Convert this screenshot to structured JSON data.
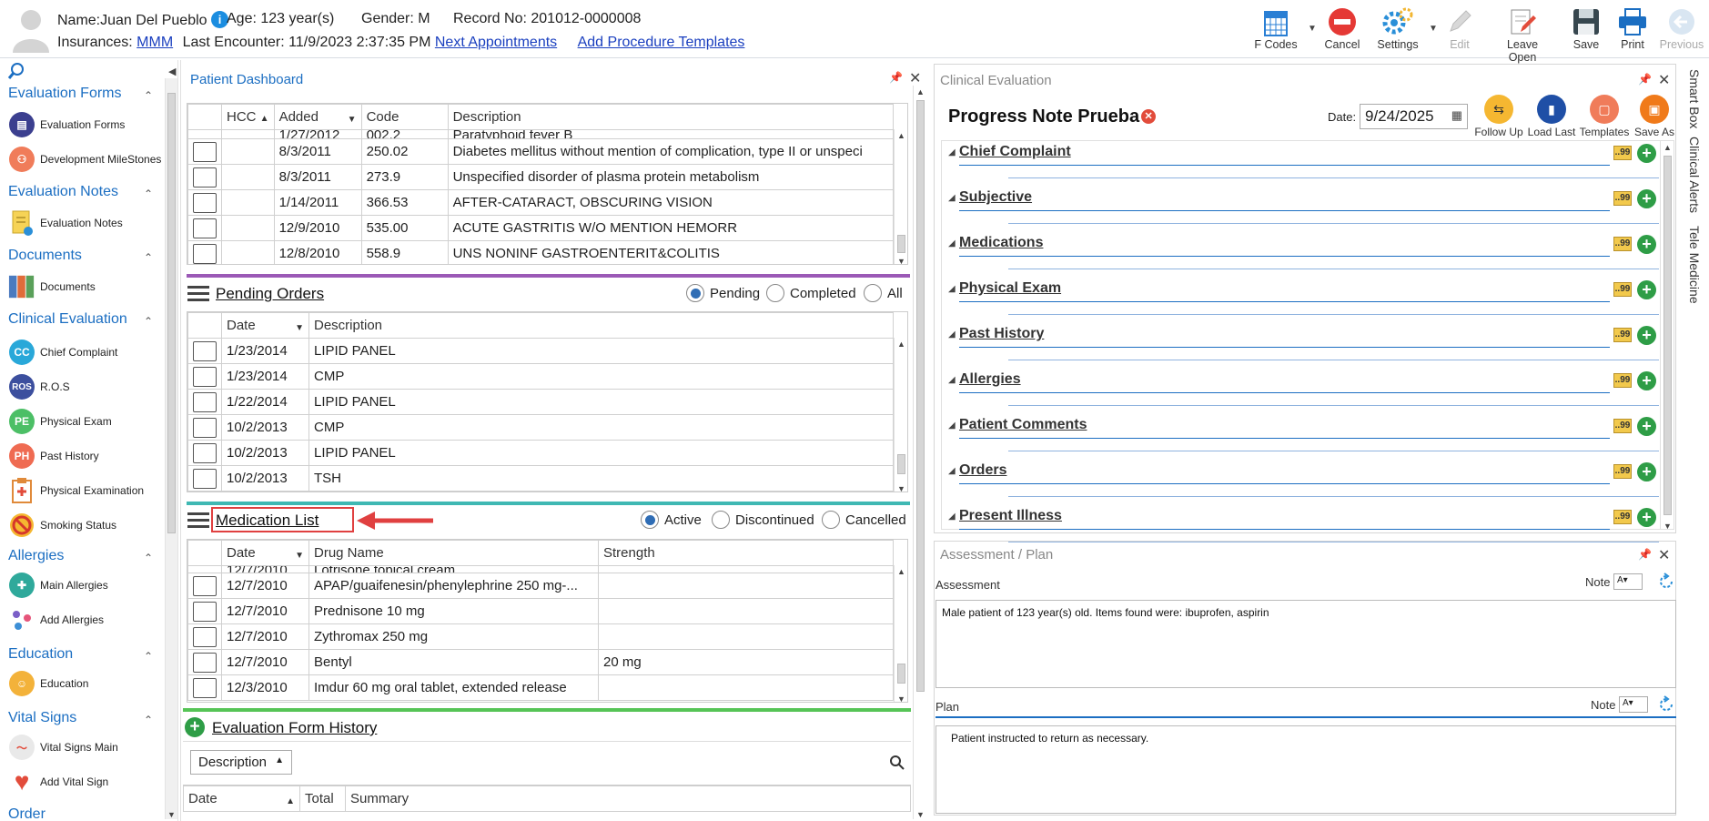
{
  "patient": {
    "name_label": "Name:",
    "name": "Juan Del Pueblo",
    "age_label": "Age:",
    "age": "123 year(s)",
    "gender_label": "Gender:",
    "gender": "M",
    "record_label": "Record No:",
    "record": "201012-0000008",
    "ins_label": "Insurances:",
    "insurance": "MMM",
    "last_label": "Last Encounter:",
    "last_encounter": "11/9/2023 2:37:35 PM",
    "next_appt": "Next Appointments",
    "add_proc": "Add Procedure Templates"
  },
  "toolbar": {
    "fcodes": "F Codes",
    "cancel": "Cancel",
    "settings": "Settings",
    "edit": "Edit",
    "leave_open": "Leave Open",
    "save": "Save",
    "print": "Print",
    "previous": "Previous"
  },
  "sidebar": {
    "evaluation_forms": "Evaluation Forms",
    "ev_forms_item": "Evaluation Forms",
    "dev_milestones": "Development MileStones",
    "evaluation_notes": "Evaluation Notes",
    "ev_notes_item": "Evaluation Notes",
    "documents": "Documents",
    "documents_item": "Documents",
    "clinical_evaluation": "Clinical Evaluation",
    "chief_complaint": "Chief Complaint",
    "ros": "R.O.S",
    "physical_exam": "Physical Exam",
    "past_history": "Past History",
    "physical_examination": "Physical Examination",
    "smoking_status": "Smoking Status",
    "allergies": "Allergies",
    "main_allergies": "Main Allergies",
    "add_allergies": "Add Allergies",
    "education": "Education",
    "education_item": "Education",
    "vital_signs": "Vital Signs",
    "vital_signs_main": "Vital Signs Main",
    "add_vital_sign": "Add Vital Sign",
    "order": "Order",
    "icon_cc": "CC",
    "icon_ros": "ROS",
    "icon_pe": "PE",
    "icon_ph": "PH"
  },
  "dashboard": {
    "title": "Patient Dashboard",
    "problems": {
      "headers": [
        "HCC",
        "Added",
        "Code",
        "Description"
      ],
      "partial_row": {
        "added": "1/27/2012",
        "code": "002.2",
        "desc": "Paratyphoid fever B"
      },
      "rows": [
        {
          "added": "8/3/2011",
          "code": "250.02",
          "desc": "Diabetes mellitus without mention of complication, type II or unspeci"
        },
        {
          "added": "8/3/2011",
          "code": "273.9",
          "desc": "Unspecified disorder of plasma protein metabolism"
        },
        {
          "added": "1/14/2011",
          "code": "366.53",
          "desc": "AFTER-CATARACT, OBSCURING VISION"
        },
        {
          "added": "12/9/2010",
          "code": "535.00",
          "desc": "ACUTE GASTRITIS W/O MENTION HEMORR"
        },
        {
          "added": "12/8/2010",
          "code": "558.9",
          "desc": "UNS NONINF GASTROENTERIT&COLITIS"
        }
      ]
    },
    "pending": {
      "title": "Pending Orders",
      "r_pending": "Pending",
      "r_completed": "Completed",
      "r_all": "All",
      "headers": [
        "Date",
        "Description"
      ],
      "rows": [
        {
          "date": "1/23/2014",
          "desc": "LIPID PANEL"
        },
        {
          "date": "1/23/2014",
          "desc": "CMP"
        },
        {
          "date": "1/22/2014",
          "desc": "LIPID PANEL"
        },
        {
          "date": "10/2/2013",
          "desc": "CMP"
        },
        {
          "date": "10/2/2013",
          "desc": "LIPID PANEL"
        },
        {
          "date": "10/2/2013",
          "desc": "TSH"
        }
      ]
    },
    "meds": {
      "title": "Medication List",
      "r_active": "Active",
      "r_discontinued": "Discontinued",
      "r_cancelled": "Cancelled",
      "headers": [
        "Date",
        "Drug Name",
        "Strength"
      ],
      "partial_row": {
        "date": "12/7/2010",
        "drug": "Lotrisone topical cream"
      },
      "rows": [
        {
          "date": "12/7/2010",
          "drug": "APAP/guaifenesin/phenylephrine 250 mg-...",
          "strength": ""
        },
        {
          "date": "12/7/2010",
          "drug": "Prednisone 10 mg",
          "strength": ""
        },
        {
          "date": "12/7/2010",
          "drug": "Zythromax 250 mg",
          "strength": ""
        },
        {
          "date": "12/7/2010",
          "drug": "Bentyl",
          "strength": "20 mg"
        },
        {
          "date": "12/3/2010",
          "drug": "Imdur 60 mg oral tablet, extended release",
          "strength": ""
        }
      ]
    },
    "history": {
      "title": "Evaluation Form History",
      "filter": "Description",
      "headers": [
        "Date",
        "Total",
        "Summary"
      ]
    }
  },
  "clinical": {
    "title": "Clinical Evaluation",
    "note_title": "Progress Note Prueba",
    "date_label": "Date:",
    "date": "9/24/2025",
    "follow_up": "Follow Up",
    "load_last": "Load Last",
    "templates": "Templates",
    "save_as": "Save As",
    "sections": [
      "Chief Complaint",
      "Subjective",
      "Medications",
      "Physical Exam",
      "Past History",
      "Allergies",
      "Patient Comments",
      "Orders",
      "Present Illness"
    ]
  },
  "assessment": {
    "title": "Assessment / Plan",
    "assessment_label": "Assessment",
    "note_label": "Note",
    "assessment_text": "Male patient of 123 year(s) old. Items found were:  ibuprofen, aspirin",
    "plan_label": "Plan",
    "plan_text": "Patient instructed to return as necessary."
  },
  "right_tabs": [
    "Smart Box",
    "Clinical Alerts",
    "Tele Medicine"
  ],
  "colors": {
    "accent": "#1b6ec2",
    "highlight": "#e04040"
  }
}
